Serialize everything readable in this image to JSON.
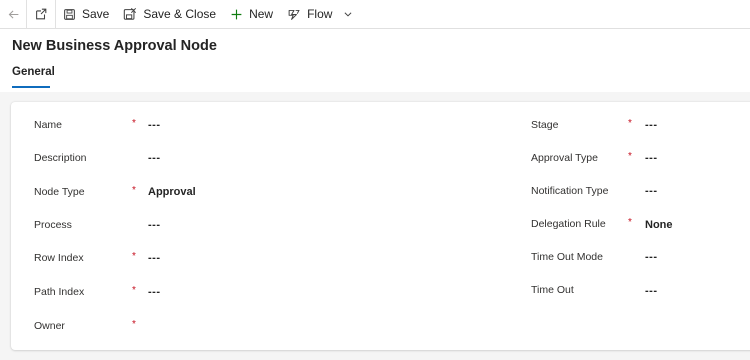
{
  "toolbar": {
    "save_label": "Save",
    "save_close_label": "Save & Close",
    "new_label": "New",
    "flow_label": "Flow"
  },
  "form": {
    "title": "New Business Approval Node",
    "tabs": [
      {
        "label": "General",
        "selected": true
      }
    ]
  },
  "fields": {
    "name": {
      "label": "Name",
      "value": "---",
      "required": "*"
    },
    "description": {
      "label": "Description",
      "value": "---"
    },
    "node_type": {
      "label": "Node Type",
      "value": "Approval",
      "required": "*"
    },
    "process": {
      "label": "Process",
      "value": "---"
    },
    "row_index": {
      "label": "Row Index",
      "value": "---",
      "required": "*"
    },
    "path_index": {
      "label": "Path Index",
      "value": "---",
      "required": "*"
    },
    "owner": {
      "label": "Owner",
      "value": "",
      "required": "*"
    },
    "stage": {
      "label": "Stage",
      "value": "---",
      "required": "*"
    },
    "approval_type": {
      "label": "Approval Type",
      "value": "---",
      "required": "*"
    },
    "notification_type": {
      "label": "Notification Type",
      "value": "---"
    },
    "delegation_rule": {
      "label": "Delegation Rule",
      "value": "None",
      "required": "*"
    },
    "time_out_mode": {
      "label": "Time Out Mode",
      "value": "---"
    },
    "time_out": {
      "label": "Time Out",
      "value": "---"
    }
  },
  "colors": {
    "accent": "#0f6cbd",
    "required": "#c50f1f",
    "new_icon": "#107c10"
  },
  "icons": [
    "back-arrow-icon",
    "pop-out-icon",
    "save-icon",
    "save-close-icon",
    "add-icon",
    "flow-icon",
    "chevron-down-icon"
  ]
}
